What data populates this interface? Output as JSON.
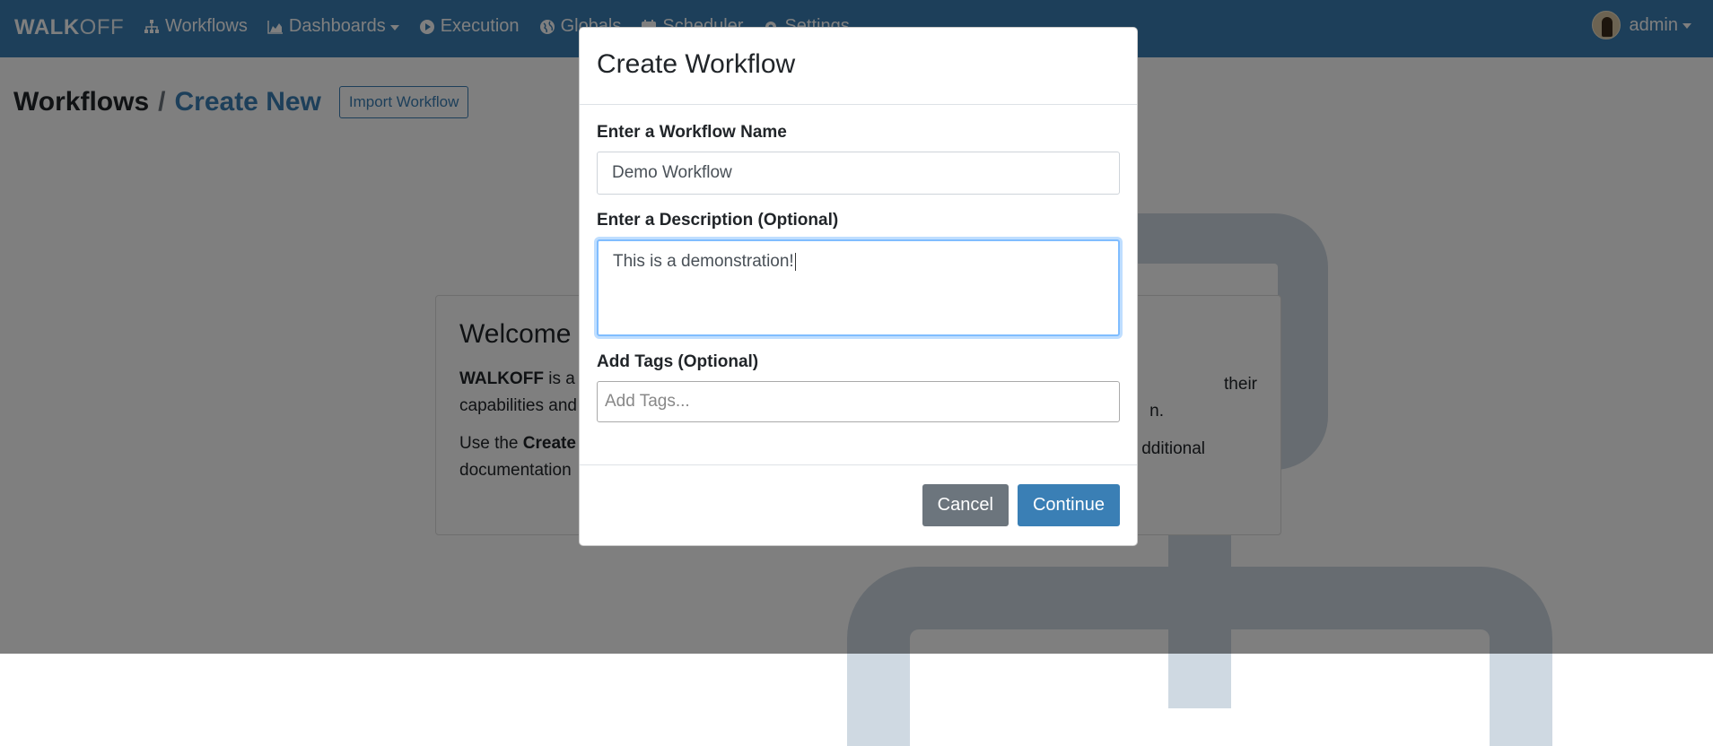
{
  "navbar": {
    "brand_bold": "WALK",
    "brand_light": "OFF",
    "items": [
      {
        "label": "Workflows",
        "icon": "sitemap-icon",
        "dropdown": false
      },
      {
        "label": "Dashboards",
        "icon": "chart-area-icon",
        "dropdown": true
      },
      {
        "label": "Execution",
        "icon": "play-circle-icon",
        "dropdown": false
      },
      {
        "label": "Globals",
        "icon": "globe-icon",
        "dropdown": false
      },
      {
        "label": "Scheduler",
        "icon": "calendar-icon",
        "dropdown": false
      },
      {
        "label": "Settings",
        "icon": "gear-icon",
        "dropdown": false
      }
    ],
    "user": {
      "name": "admin"
    }
  },
  "page": {
    "breadcrumb_root": "Workflows",
    "breadcrumb_sep": "/",
    "breadcrumb_current": "Create New",
    "import_label": "Import Workflow"
  },
  "welcome": {
    "title": "Welcome",
    "p1_bold": "WALKOFF",
    "p1_start": " is a",
    "p1_end": "their",
    "p1_line2_start": "capabilities and",
    "p1_line2_end": "n.",
    "p2_start": "Use the ",
    "p2_bold": "Create",
    "p2_end": "dditional",
    "p2_line2": "documentation"
  },
  "modal": {
    "title": "Create Workflow",
    "name_label": "Enter a Workflow Name",
    "name_value": "Demo Workflow",
    "description_label": "Enter a Description (Optional)",
    "description_value": "This is a demonstration!",
    "tags_label": "Add Tags (Optional)",
    "tags_placeholder": "Add Tags...",
    "cancel_label": "Cancel",
    "continue_label": "Continue"
  },
  "colors": {
    "navbar": "#3a7fb5",
    "primary": "#3a7fb5",
    "secondary": "#6c757d"
  }
}
